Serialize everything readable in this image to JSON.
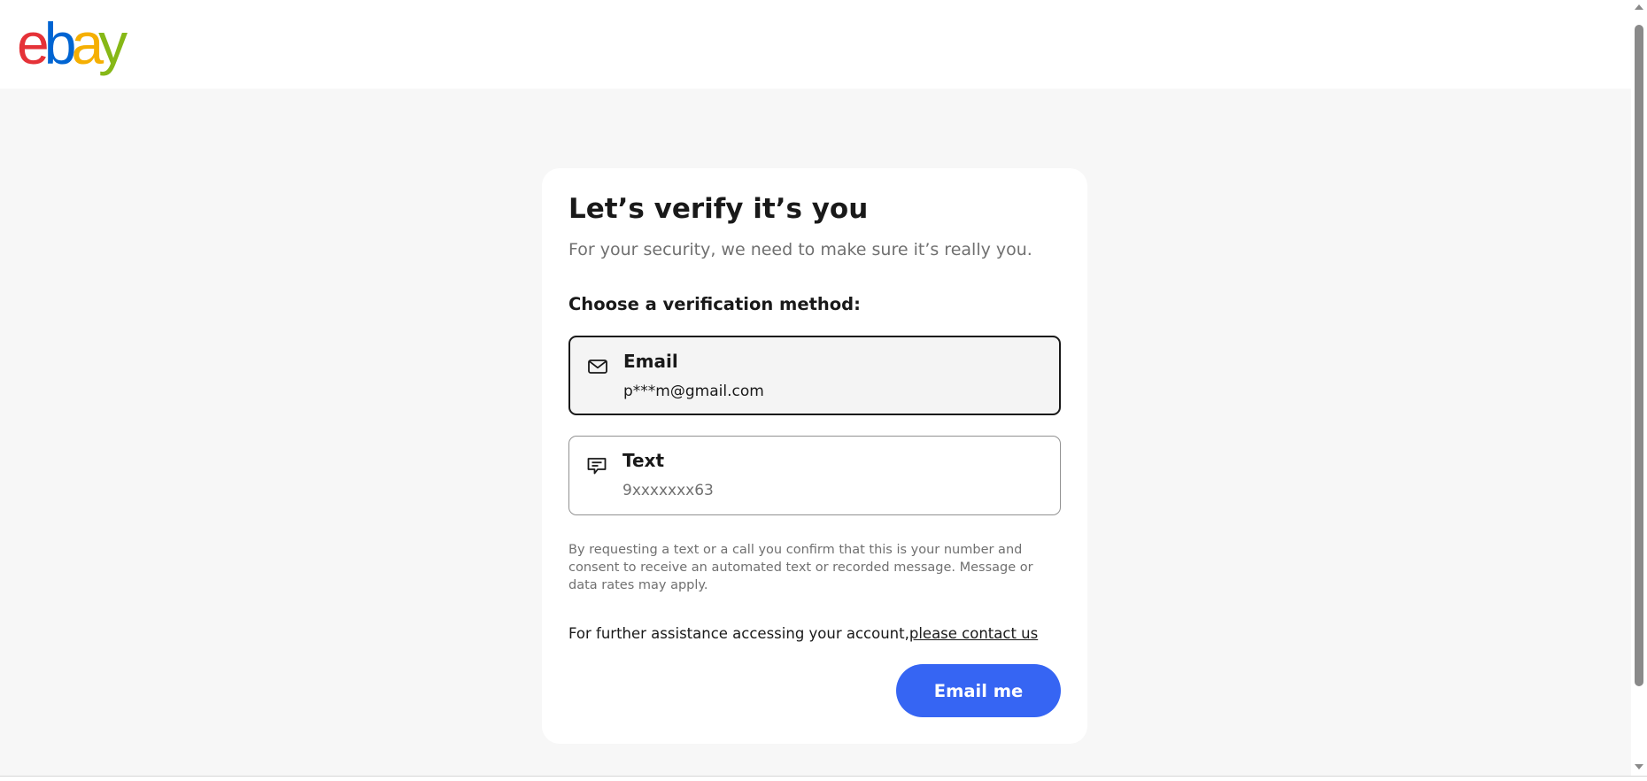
{
  "header": {
    "logo": {
      "letters": [
        "e",
        "b",
        "a",
        "y"
      ],
      "colors": [
        "#e53238",
        "#0064d2",
        "#f5af02",
        "#86b817"
      ]
    }
  },
  "verify": {
    "title": "Let’s verify it’s you",
    "subtitle": "For your security, we need to make sure it’s really you.",
    "choose_label": "Choose a verification method:",
    "options": [
      {
        "icon": "envelope-icon",
        "title": "Email",
        "detail": "p***m@gmail.com",
        "selected": true
      },
      {
        "icon": "chat-bubble-icon",
        "title": "Text",
        "detail": "9xxxxxxx63",
        "selected": false
      }
    ],
    "disclaimer": "By requesting a text or a call you confirm that this is your number and consent to receive an automated text or recorded message. Message or data rates may apply.",
    "assist_text": "For further assistance accessing your account,",
    "contact_link": "please contact us",
    "submit_label": "Email me"
  },
  "colors": {
    "accent": "#3665f3",
    "text_primary": "#191919",
    "text_secondary": "#707070",
    "page_background": "#f7f7f7"
  }
}
